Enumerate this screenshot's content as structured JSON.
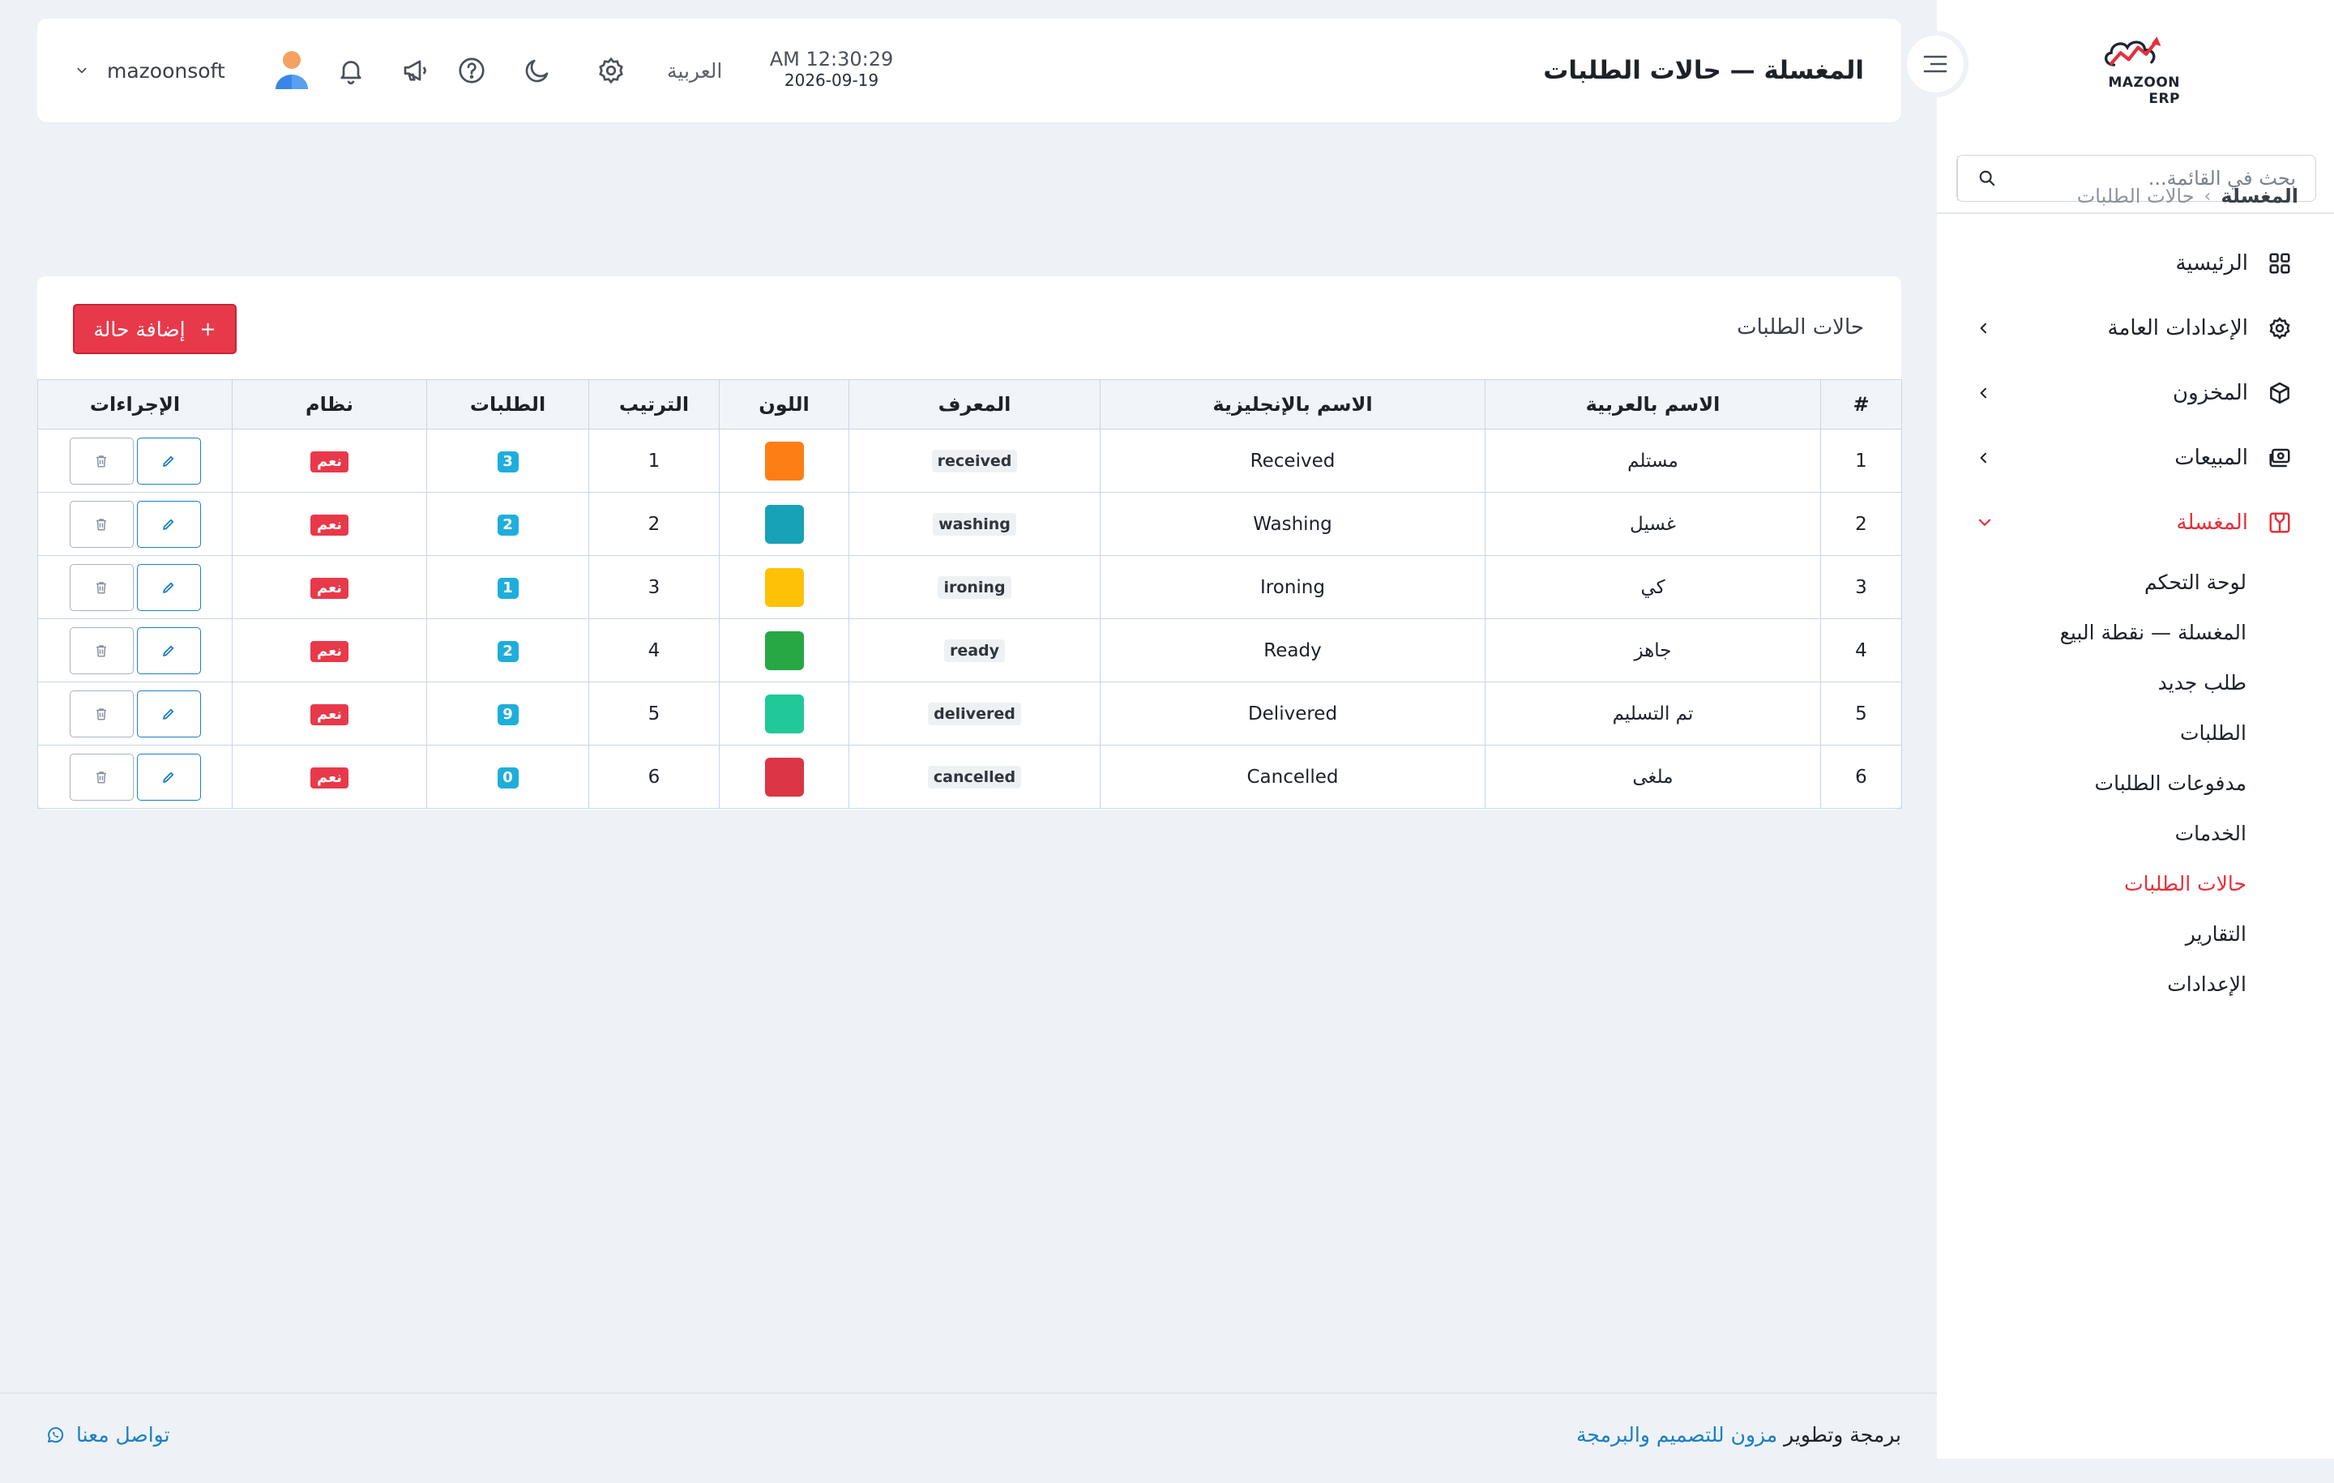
{
  "header": {
    "title": "المغسلة — حالات الطلبات",
    "time": "AM 12:30:29",
    "date": "2026-09-19",
    "language": "العربية",
    "username": "mazoonsoft"
  },
  "sidebar": {
    "logo_text": "MAZOON ERP",
    "search_placeholder": "بحث في القائمة...",
    "items": [
      {
        "label": "الرئيسية",
        "icon": "grid-icon"
      },
      {
        "label": "الإعدادات العامة",
        "icon": "gear-icon"
      },
      {
        "label": "المخزون",
        "icon": "box-icon"
      },
      {
        "label": "المبيعات",
        "icon": "cash-icon"
      },
      {
        "label": "المغسلة",
        "icon": "laundry-icon"
      }
    ],
    "sub_items": [
      "لوحة التحكم",
      "المغسلة — نقطة البيع",
      "طلب جديد",
      "الطلبات",
      "مدفوعات الطلبات",
      "الخدمات",
      "حالات الطلبات",
      "التقارير",
      "الإعدادات"
    ]
  },
  "breadcrumb": {
    "home": "المغسلة",
    "current": "حالات الطلبات"
  },
  "card": {
    "title": "حالات الطلبات",
    "add_button": "إضافة حالة"
  },
  "table": {
    "headers": [
      "#",
      "الاسم بالعربية",
      "الاسم بالإنجليزية",
      "المعرف",
      "اللون",
      "الترتيب",
      "الطلبات",
      "نظام",
      "الإجراءات"
    ],
    "rows": [
      {
        "num": "1",
        "ar": "مستلم",
        "en": "Received",
        "code": "received",
        "color": "#fd7e14",
        "order": "1",
        "count": "3",
        "system": "نعم"
      },
      {
        "num": "2",
        "ar": "غسيل",
        "en": "Washing",
        "code": "washing",
        "color": "#17a2b8",
        "order": "2",
        "count": "2",
        "system": "نعم"
      },
      {
        "num": "3",
        "ar": "كي",
        "en": "Ironing",
        "code": "ironing",
        "color": "#ffc107",
        "order": "3",
        "count": "1",
        "system": "نعم"
      },
      {
        "num": "4",
        "ar": "جاهز",
        "en": "Ready",
        "code": "ready",
        "color": "#28a745",
        "order": "4",
        "count": "2",
        "system": "نعم"
      },
      {
        "num": "5",
        "ar": "تم التسليم",
        "en": "Delivered",
        "code": "delivered",
        "color": "#20c997",
        "order": "5",
        "count": "9",
        "system": "نعم"
      },
      {
        "num": "6",
        "ar": "ملغى",
        "en": "Cancelled",
        "code": "cancelled",
        "color": "#dc3545",
        "order": "6",
        "count": "0",
        "system": "نعم"
      }
    ]
  },
  "footer": {
    "prefix": "برمجة وتطوير",
    "company_link": "مزون للتصميم والبرمجة",
    "contact": "تواصل معنا"
  },
  "colors": {
    "accent": "#e8394a",
    "link": "#1a7fc1",
    "badge": "#1eaedb",
    "background": "#eef2f6"
  }
}
